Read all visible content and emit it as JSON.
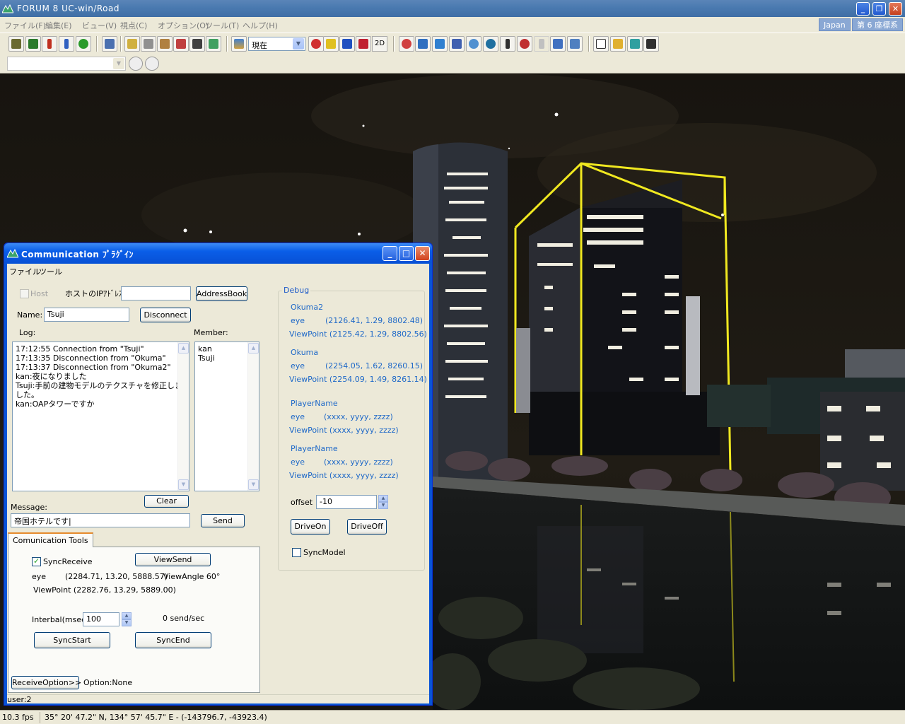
{
  "main_window": {
    "title": "FORUM 8    UC-win/Road",
    "menu": [
      "ファイル(F)",
      "編集(E)",
      "ビュー(V)",
      "視点(C)",
      "オプション(O)",
      "ツール(T)",
      "ヘルプ(H)"
    ],
    "menu_right": [
      "Japan",
      "第 6 座標系"
    ],
    "view_combo": "現在",
    "btn_2d": "2D",
    "toolbar2_combo": ""
  },
  "status_bar": {
    "fps": "10.3 fps",
    "coords": "35°  20' 47.2\" N, 134°   57' 45.7\" E  -  (-143796.7, -43923.4)"
  },
  "dialog": {
    "title": "Communication ﾌﾟﾗｸﾞｲﾝ",
    "menu": [
      "ファイル",
      "ツール"
    ],
    "host_label": "Host",
    "host_ip_label": "ホストのIPｱﾄﾞﾚｽ:",
    "host_ip_value": "",
    "address_book": "AddressBook",
    "name_label": "Name:",
    "name_value": "Tsuji",
    "disconnect": "Disconnect",
    "log_label": "Log:",
    "member_label": "Member:",
    "log": [
      "17:12:55 Connection from \"Tsuji\"",
      "17:13:35 Disconnection from \"Okuma\"",
      "17:13:37 Disconnection from \"Okuma2\"",
      "kan:夜になりました",
      "Tsuji:手前の建物モデルのテクスチャを修正しま",
      "した。",
      "kan:OAPタワーですか"
    ],
    "members": [
      "kan",
      "Tsuji"
    ],
    "clear": "Clear",
    "message_label": "Message:",
    "message_value": "帝国ホテルです|",
    "send": "Send",
    "tab_label": "Comunication Tools",
    "sync_receive": "SyncReceive",
    "view_send": "ViewSend",
    "eye_label": "eye",
    "eye_value": "(2284.71, 13.20, 5888.57)",
    "view_angle": "ViewAngle  60°",
    "viewpoint_text": "ViewPoint (2282.76, 13.29, 5889.00)",
    "interval_label": "Interbal(msec)",
    "interval_value": "100",
    "send_rate": "0 send/sec",
    "sync_start": "SyncStart",
    "sync_end": "SyncEnd",
    "receive_option": "ReceiveOption>>",
    "option_text": "Option:None",
    "status_text": "user:2",
    "debug": {
      "caption": "Debug",
      "players": [
        {
          "name": "Okuma2",
          "eye": "(2126.41, 1.29, 8802.48)",
          "viewpoint": "ViewPoint (2125.42, 1.29, 8802.56)"
        },
        {
          "name": "Okuma",
          "eye": "(2254.05, 1.62, 8260.15)",
          "viewpoint": "ViewPoint (2254.09, 1.49, 8261.14)"
        },
        {
          "name": "PlayerName",
          "eye": "(xxxx, yyyy, zzzz)",
          "viewpoint": "ViewPoint (xxxx, yyyy, zzzz)"
        },
        {
          "name": "PlayerName",
          "eye": "(xxxx, yyyy, zzzz)",
          "viewpoint": "ViewPoint (xxxx, yyyy, zzzz)"
        }
      ],
      "eye_label": "eye",
      "offset_label": "offset",
      "offset_value": "-10",
      "drive_on": "DriveOn",
      "drive_off": "DriveOff",
      "sync_model": "SyncModel"
    }
  },
  "colors": {
    "highlight": "#f0e820",
    "sky": "#14120f",
    "dialog_frame": "#0854d6"
  }
}
